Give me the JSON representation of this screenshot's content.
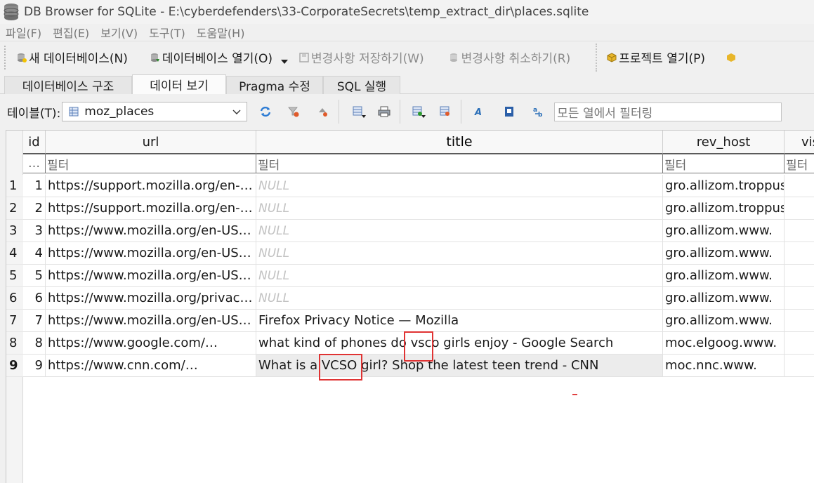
{
  "window": {
    "title": "DB Browser for SQLite - E:\\cyberdefenders\\33-CorporateSecrets\\temp_extract_dir\\places.sqlite"
  },
  "menu": [
    "파일(F)",
    "편집(E)",
    "보기(V)",
    "도구(T)",
    "도움말(H)"
  ],
  "toolbar": {
    "new_db": "새 데이터베이스(N)",
    "open_db": "데이터베이스 열기(O)",
    "write_changes": "변경사항 저장하기(W)",
    "revert_changes": "변경사항 취소하기(R)",
    "open_project": "프로젝트 열기(P)"
  },
  "tabs": [
    "데이터베이스 구조",
    "데이터 보기",
    "Pragma 수정",
    "SQL 실행"
  ],
  "active_tab": "데이터 보기",
  "table_selector": {
    "label": "테이블(T):",
    "value": "moz_places"
  },
  "filter_all": {
    "placeholder": "모든 열에서 필터링"
  },
  "grid": {
    "columns": [
      "id",
      "url",
      "title",
      "rev_host",
      "visit"
    ],
    "filter_placeholder": "필터",
    "id_filter": "…",
    "rows": [
      {
        "rownum": "1",
        "id": "1",
        "url": "https://support.mozilla.org/en-…",
        "title": "NULL",
        "rev_host": "gro.allizom.troppus."
      },
      {
        "rownum": "2",
        "id": "2",
        "url": "https://support.mozilla.org/en-…",
        "title": "NULL",
        "rev_host": "gro.allizom.troppus."
      },
      {
        "rownum": "3",
        "id": "3",
        "url": "https://www.mozilla.org/en-US…",
        "title": "NULL",
        "rev_host": "gro.allizom.www."
      },
      {
        "rownum": "4",
        "id": "4",
        "url": "https://www.mozilla.org/en-US…",
        "title": "NULL",
        "rev_host": "gro.allizom.www."
      },
      {
        "rownum": "5",
        "id": "5",
        "url": "https://www.mozilla.org/en-US…",
        "title": "NULL",
        "rev_host": "gro.allizom.www."
      },
      {
        "rownum": "6",
        "id": "6",
        "url": "https://www.mozilla.org/privac…",
        "title": "NULL",
        "rev_host": "gro.allizom.www."
      },
      {
        "rownum": "7",
        "id": "7",
        "url": "https://www.mozilla.org/en-US…",
        "title": "Firefox Privacy Notice — Mozilla",
        "rev_host": "gro.allizom.www."
      },
      {
        "rownum": "8",
        "id": "8",
        "url": "https://www.google.com/…",
        "title": "what kind of phones do vsco girls enjoy - Google Search",
        "rev_host": "moc.elgoog.www."
      },
      {
        "rownum": "9",
        "id": "9",
        "url": "https://www.cnn.com/…",
        "title": "What is a VCSO girl? Shop the latest teen trend - CNN",
        "rev_host": "moc.nnc.www."
      }
    ],
    "null_style_color": "#c2c2c2",
    "selected_row": "9"
  },
  "annotations": {
    "highlight_color": "#e03333"
  }
}
